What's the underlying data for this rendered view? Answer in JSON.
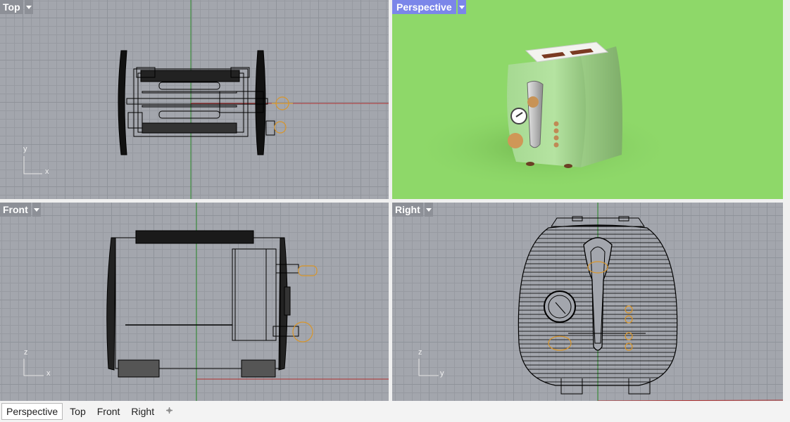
{
  "viewports": {
    "top": {
      "label": "Top",
      "axis_a": "y",
      "axis_b": "x"
    },
    "perspective": {
      "label": "Perspective"
    },
    "front": {
      "label": "Front",
      "axis_a": "z",
      "axis_b": "x"
    },
    "right": {
      "label": "Right",
      "axis_a": "z",
      "axis_b": "y"
    }
  },
  "tabs": [
    {
      "label": "Perspective",
      "active": true
    },
    {
      "label": "Top",
      "active": false
    },
    {
      "label": "Front",
      "active": false
    },
    {
      "label": "Right",
      "active": false
    }
  ],
  "add_tab_icon": "plus-icon",
  "colors": {
    "grid_bg": "#a3a6ad",
    "label_bg": "#8d9097",
    "active_label_bg": "#7b86e9",
    "render_bg": "#8ed869",
    "toaster_body": "#a7d991",
    "x_axis": "#b03030",
    "y_axis": "#2c8c2c",
    "gizmo": "#d9962a"
  }
}
